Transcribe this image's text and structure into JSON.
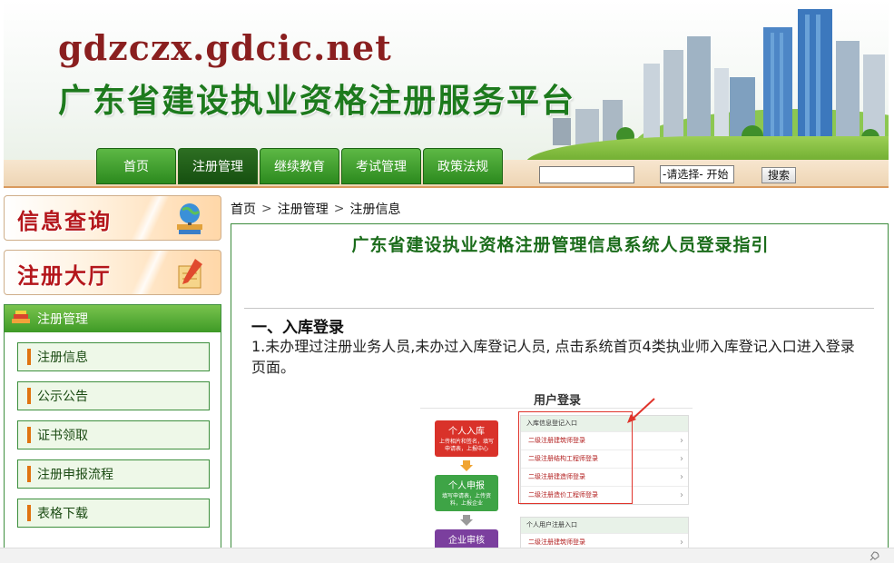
{
  "header": {
    "domain": "gdzczx.gdcic.net",
    "title": "广东省建设执业资格注册服务平台"
  },
  "nav": {
    "items": [
      {
        "label": "首页"
      },
      {
        "label": "注册管理"
      },
      {
        "label": "继续教育"
      },
      {
        "label": "考试管理"
      },
      {
        "label": "政策法规"
      }
    ],
    "select_value": "-请选择- 开始",
    "search_button": "搜索"
  },
  "sidebar": {
    "banner_info": "信息查询",
    "banner_register": "注册大厅",
    "panel_title": "注册管理",
    "items": [
      {
        "label": "注册信息"
      },
      {
        "label": "公示公告"
      },
      {
        "label": "证书领取"
      },
      {
        "label": "注册申报流程"
      },
      {
        "label": "表格下载"
      }
    ]
  },
  "breadcrumb": [
    "首页",
    "注册管理",
    "注册信息"
  ],
  "main": {
    "doc_title": "广东省建设执业资格注册管理信息系统人员登录指引",
    "section_heading": "一、入库登录",
    "paragraph": "1.未办理过注册业务人员,未办过入库登记人员, 点击系统首页4类执业师入库登记入口进入登录页面。",
    "figure": {
      "title": "用户登录",
      "steps": [
        {
          "title": "个人入库",
          "desc": "上传相片和签名，填写申请表，上报中心"
        },
        {
          "title": "个人申报",
          "desc": "填写申请表，上传资料，上报企业"
        },
        {
          "title": "企业审核"
        }
      ],
      "group1_title": "入库信息登记入口",
      "group1_rows": [
        "二级注册建筑师登录",
        "二级注册结构工程师登录",
        "二级注册建造师登录",
        "二级注册造价工程师登录"
      ],
      "group2_title": "个人用户注册入口",
      "group2_rows": [
        "二级注册建筑师登录"
      ]
    }
  }
}
